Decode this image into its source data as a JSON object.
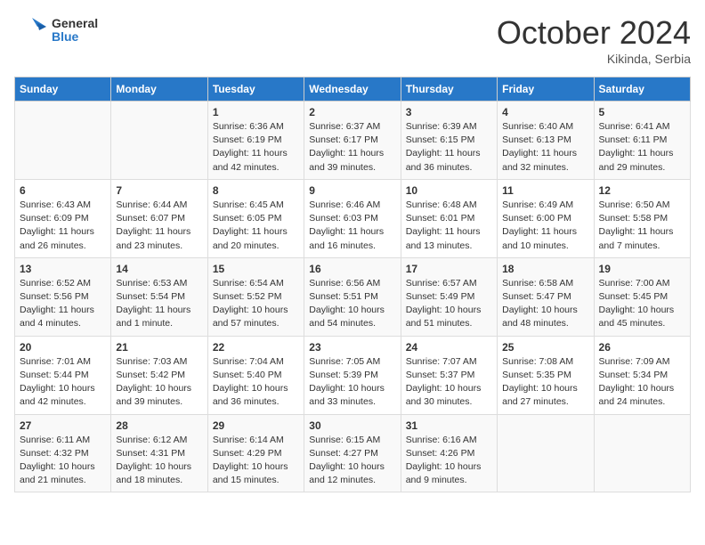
{
  "logo": {
    "general": "General",
    "blue": "Blue"
  },
  "title": "October 2024",
  "subtitle": "Kikinda, Serbia",
  "weekdays": [
    "Sunday",
    "Monday",
    "Tuesday",
    "Wednesday",
    "Thursday",
    "Friday",
    "Saturday"
  ],
  "weeks": [
    [
      null,
      null,
      {
        "day": "1",
        "sunrise": "Sunrise: 6:36 AM",
        "sunset": "Sunset: 6:19 PM",
        "daylight": "Daylight: 11 hours and 42 minutes."
      },
      {
        "day": "2",
        "sunrise": "Sunrise: 6:37 AM",
        "sunset": "Sunset: 6:17 PM",
        "daylight": "Daylight: 11 hours and 39 minutes."
      },
      {
        "day": "3",
        "sunrise": "Sunrise: 6:39 AM",
        "sunset": "Sunset: 6:15 PM",
        "daylight": "Daylight: 11 hours and 36 minutes."
      },
      {
        "day": "4",
        "sunrise": "Sunrise: 6:40 AM",
        "sunset": "Sunset: 6:13 PM",
        "daylight": "Daylight: 11 hours and 32 minutes."
      },
      {
        "day": "5",
        "sunrise": "Sunrise: 6:41 AM",
        "sunset": "Sunset: 6:11 PM",
        "daylight": "Daylight: 11 hours and 29 minutes."
      }
    ],
    [
      {
        "day": "6",
        "sunrise": "Sunrise: 6:43 AM",
        "sunset": "Sunset: 6:09 PM",
        "daylight": "Daylight: 11 hours and 26 minutes."
      },
      {
        "day": "7",
        "sunrise": "Sunrise: 6:44 AM",
        "sunset": "Sunset: 6:07 PM",
        "daylight": "Daylight: 11 hours and 23 minutes."
      },
      {
        "day": "8",
        "sunrise": "Sunrise: 6:45 AM",
        "sunset": "Sunset: 6:05 PM",
        "daylight": "Daylight: 11 hours and 20 minutes."
      },
      {
        "day": "9",
        "sunrise": "Sunrise: 6:46 AM",
        "sunset": "Sunset: 6:03 PM",
        "daylight": "Daylight: 11 hours and 16 minutes."
      },
      {
        "day": "10",
        "sunrise": "Sunrise: 6:48 AM",
        "sunset": "Sunset: 6:01 PM",
        "daylight": "Daylight: 11 hours and 13 minutes."
      },
      {
        "day": "11",
        "sunrise": "Sunrise: 6:49 AM",
        "sunset": "Sunset: 6:00 PM",
        "daylight": "Daylight: 11 hours and 10 minutes."
      },
      {
        "day": "12",
        "sunrise": "Sunrise: 6:50 AM",
        "sunset": "Sunset: 5:58 PM",
        "daylight": "Daylight: 11 hours and 7 minutes."
      }
    ],
    [
      {
        "day": "13",
        "sunrise": "Sunrise: 6:52 AM",
        "sunset": "Sunset: 5:56 PM",
        "daylight": "Daylight: 11 hours and 4 minutes."
      },
      {
        "day": "14",
        "sunrise": "Sunrise: 6:53 AM",
        "sunset": "Sunset: 5:54 PM",
        "daylight": "Daylight: 11 hours and 1 minute."
      },
      {
        "day": "15",
        "sunrise": "Sunrise: 6:54 AM",
        "sunset": "Sunset: 5:52 PM",
        "daylight": "Daylight: 10 hours and 57 minutes."
      },
      {
        "day": "16",
        "sunrise": "Sunrise: 6:56 AM",
        "sunset": "Sunset: 5:51 PM",
        "daylight": "Daylight: 10 hours and 54 minutes."
      },
      {
        "day": "17",
        "sunrise": "Sunrise: 6:57 AM",
        "sunset": "Sunset: 5:49 PM",
        "daylight": "Daylight: 10 hours and 51 minutes."
      },
      {
        "day": "18",
        "sunrise": "Sunrise: 6:58 AM",
        "sunset": "Sunset: 5:47 PM",
        "daylight": "Daylight: 10 hours and 48 minutes."
      },
      {
        "day": "19",
        "sunrise": "Sunrise: 7:00 AM",
        "sunset": "Sunset: 5:45 PM",
        "daylight": "Daylight: 10 hours and 45 minutes."
      }
    ],
    [
      {
        "day": "20",
        "sunrise": "Sunrise: 7:01 AM",
        "sunset": "Sunset: 5:44 PM",
        "daylight": "Daylight: 10 hours and 42 minutes."
      },
      {
        "day": "21",
        "sunrise": "Sunrise: 7:03 AM",
        "sunset": "Sunset: 5:42 PM",
        "daylight": "Daylight: 10 hours and 39 minutes."
      },
      {
        "day": "22",
        "sunrise": "Sunrise: 7:04 AM",
        "sunset": "Sunset: 5:40 PM",
        "daylight": "Daylight: 10 hours and 36 minutes."
      },
      {
        "day": "23",
        "sunrise": "Sunrise: 7:05 AM",
        "sunset": "Sunset: 5:39 PM",
        "daylight": "Daylight: 10 hours and 33 minutes."
      },
      {
        "day": "24",
        "sunrise": "Sunrise: 7:07 AM",
        "sunset": "Sunset: 5:37 PM",
        "daylight": "Daylight: 10 hours and 30 minutes."
      },
      {
        "day": "25",
        "sunrise": "Sunrise: 7:08 AM",
        "sunset": "Sunset: 5:35 PM",
        "daylight": "Daylight: 10 hours and 27 minutes."
      },
      {
        "day": "26",
        "sunrise": "Sunrise: 7:09 AM",
        "sunset": "Sunset: 5:34 PM",
        "daylight": "Daylight: 10 hours and 24 minutes."
      }
    ],
    [
      {
        "day": "27",
        "sunrise": "Sunrise: 6:11 AM",
        "sunset": "Sunset: 4:32 PM",
        "daylight": "Daylight: 10 hours and 21 minutes."
      },
      {
        "day": "28",
        "sunrise": "Sunrise: 6:12 AM",
        "sunset": "Sunset: 4:31 PM",
        "daylight": "Daylight: 10 hours and 18 minutes."
      },
      {
        "day": "29",
        "sunrise": "Sunrise: 6:14 AM",
        "sunset": "Sunset: 4:29 PM",
        "daylight": "Daylight: 10 hours and 15 minutes."
      },
      {
        "day": "30",
        "sunrise": "Sunrise: 6:15 AM",
        "sunset": "Sunset: 4:27 PM",
        "daylight": "Daylight: 10 hours and 12 minutes."
      },
      {
        "day": "31",
        "sunrise": "Sunrise: 6:16 AM",
        "sunset": "Sunset: 4:26 PM",
        "daylight": "Daylight: 10 hours and 9 minutes."
      },
      null,
      null
    ]
  ]
}
